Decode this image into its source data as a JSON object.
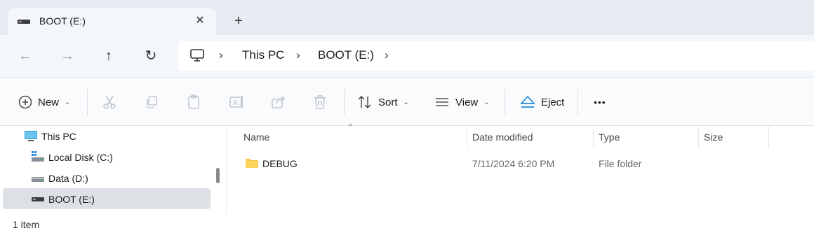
{
  "tab": {
    "title": "BOOT (E:)",
    "close": "✕",
    "new_tab": "+"
  },
  "nav": {
    "back": "←",
    "forward": "→",
    "up": "↑",
    "refresh": "↻"
  },
  "breadcrumb": {
    "items": [
      "This PC",
      "BOOT (E:)"
    ],
    "separator": "›"
  },
  "commands": {
    "new_label": "New",
    "sort_label": "Sort",
    "view_label": "View",
    "eject_label": "Eject",
    "more_label": "•••",
    "chevron": "⌄"
  },
  "sidebar": {
    "items": [
      {
        "label": "This PC",
        "icon": "monitor-icon"
      },
      {
        "label": "Local Disk (C:)",
        "icon": "system-drive-icon"
      },
      {
        "label": "Data (D:)",
        "icon": "drive-icon"
      },
      {
        "label": "BOOT (E:)",
        "icon": "usb-drive-icon",
        "selected": true
      }
    ]
  },
  "columns": {
    "name": "Name",
    "date": "Date modified",
    "type": "Type",
    "size": "Size",
    "sort_indicator": "^"
  },
  "files": [
    {
      "name": "DEBUG",
      "date": "7/11/2024 6:20 PM",
      "type": "File folder",
      "size": ""
    }
  ],
  "status": {
    "count": "1 item"
  },
  "colors": {
    "folder": "#f8c542",
    "accent": "#0078d4",
    "selected_bg": "#dde0e4"
  }
}
